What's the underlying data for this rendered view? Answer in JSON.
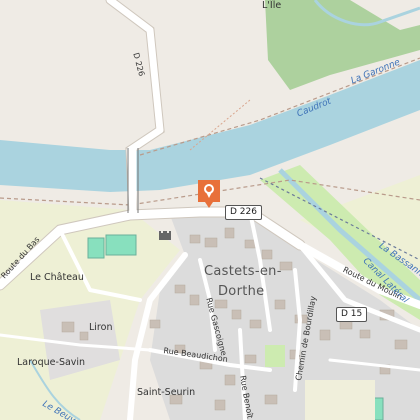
{
  "map": {
    "labels": {
      "l_ile": "L'Île",
      "la_garonne": "La Garonne",
      "caudrot": "Caudrot",
      "d226_vertical": "D 226",
      "route_du_bas": "Route du Bas",
      "le_chateau": "Le Château",
      "liron": "Liron",
      "laroque_savin": "Laroque-Savin",
      "saint_seurin": "Saint-Seurin",
      "le_beuve": "Le Beuve",
      "castets_line1": "Castets-en-",
      "castets_line2": "Dorthe",
      "route_du_moulin": "Route du Moulin",
      "rue_gascoigne": "Rue Gascoigne",
      "rue_beaudichon": "Rue Beaudichon",
      "chemin_de_bourdillay": "Chemin de Bourdillay",
      "rue_benoit": "Rue Benoît",
      "la_bassanne": "La Bassanne",
      "canal_lateral": "Canal Latéral"
    },
    "shields": {
      "d226": "D 226",
      "d15": "D 15"
    },
    "markers": {
      "location": "map-pin-icon",
      "castle": "castle-icon"
    },
    "colors": {
      "background": "#efebe5",
      "river": "#aad3df",
      "forest": "#add19e",
      "grass": "#cdebb0",
      "farmland": "#eef0d5",
      "residential": "#dddddd",
      "pitch": "#88e0be",
      "road": "#ffffff",
      "pin": "#e8703a"
    }
  }
}
